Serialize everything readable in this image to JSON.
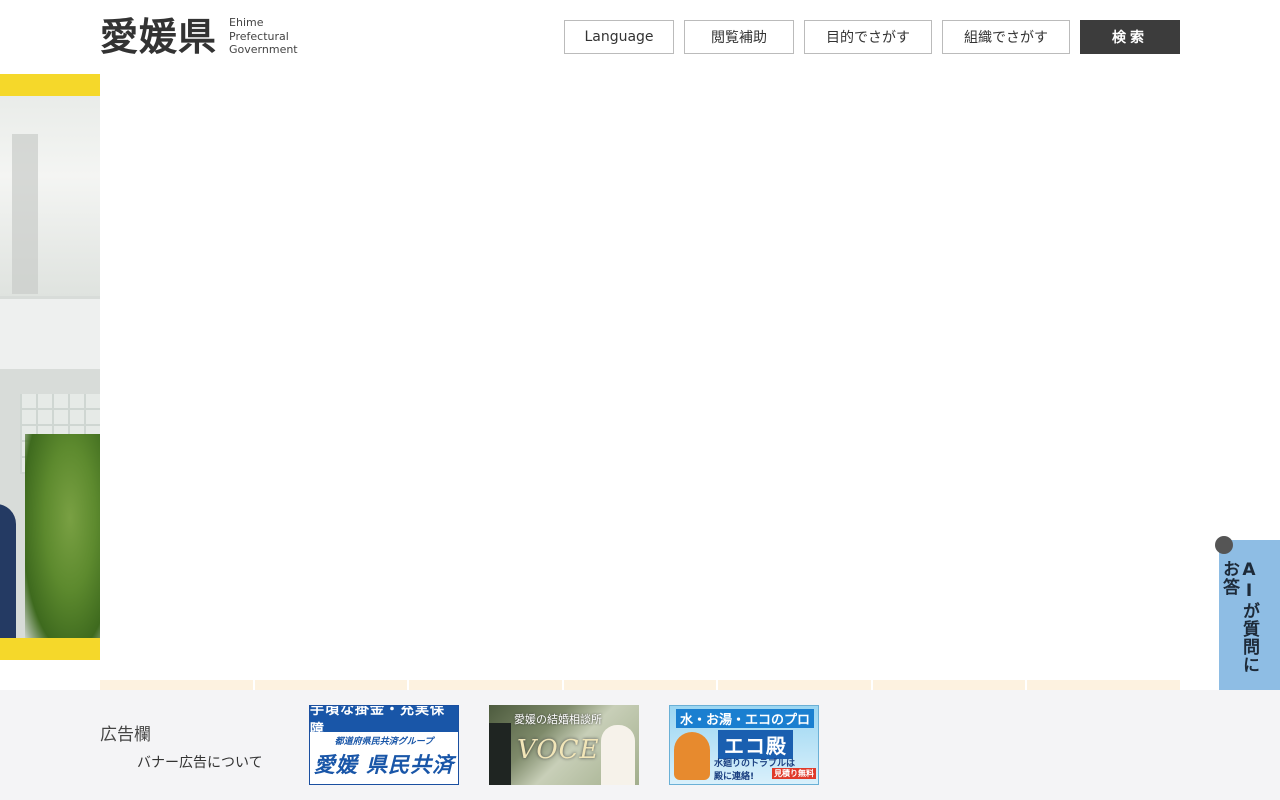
{
  "header": {
    "logo_kanji": "愛媛県",
    "logo_en_line1": "Ehime",
    "logo_en_line2": "Prefectural",
    "logo_en_line3": "Government",
    "nav": {
      "language": "Language",
      "reading_assist": "閲覧補助",
      "by_purpose": "目的でさがす",
      "by_organization": "組織でさがす",
      "search": "検索"
    }
  },
  "ads": {
    "label": "広告欄",
    "about_link": "バナー広告について",
    "banner1": {
      "top": "手頃な掛金・充実保障",
      "mid": "都道府県民共済グループ",
      "bottom": "愛媛 県民共済"
    },
    "banner2": {
      "title": "愛媛の結婚相談所",
      "brand": "VOCE"
    },
    "banner3": {
      "top": "水・お湯・エコのプロ",
      "brand": "エコ殿",
      "line1": "水廻りのトラブルは",
      "line2": "殿に連絡!",
      "badge": "見積り無料"
    }
  },
  "ai_widget": {
    "label": "AIが質問にお答"
  },
  "colors": {
    "accent_yellow": "#f5d82a",
    "search_bg": "#3c3c3c",
    "ad_bg": "#f4f4f6",
    "ai_tab": "#8ebde4"
  }
}
